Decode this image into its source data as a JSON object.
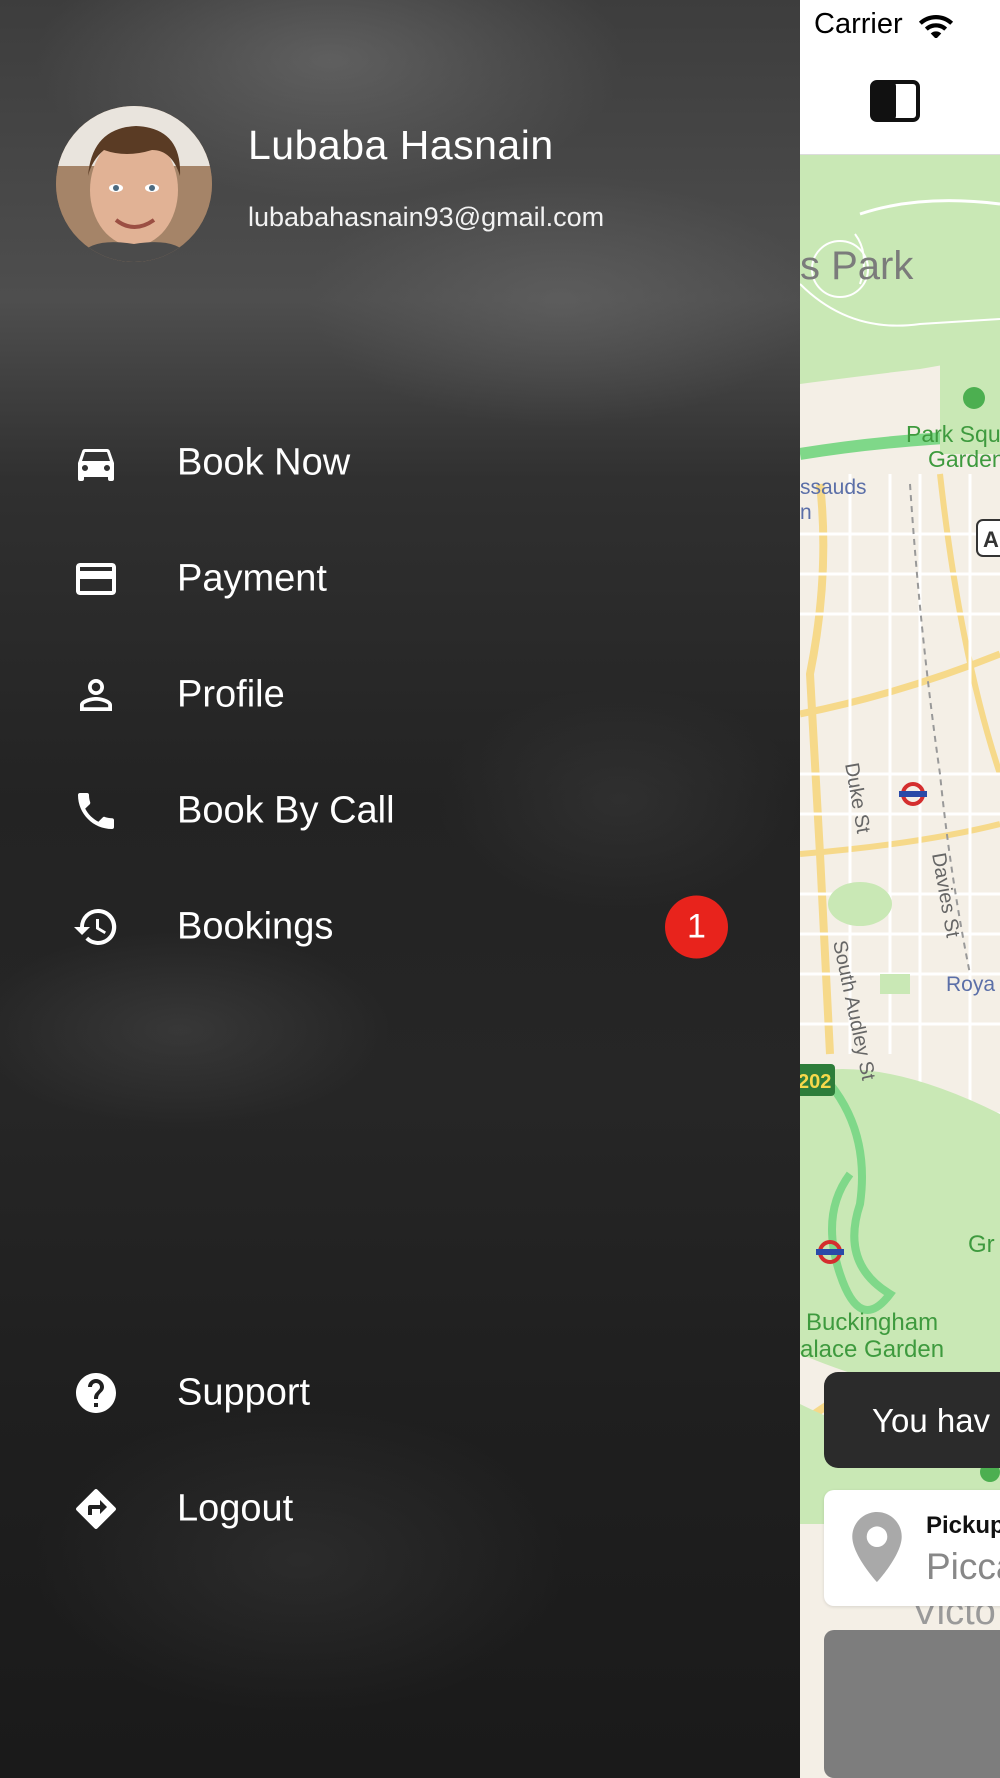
{
  "status_bar": {
    "carrier": "Carrier"
  },
  "drawer": {
    "user": {
      "name": "Lubaba Hasnain",
      "email": "lubabahasnain93@gmail.com"
    },
    "menu": [
      {
        "label": "Book Now",
        "icon": "car-icon"
      },
      {
        "label": "Payment",
        "icon": "credit-card-icon"
      },
      {
        "label": "Profile",
        "icon": "person-icon"
      },
      {
        "label": "Book By Call",
        "icon": "phone-icon"
      },
      {
        "label": "Bookings",
        "icon": "history-icon",
        "badge": "1"
      }
    ],
    "footer_menu": [
      {
        "label": "Support",
        "icon": "help-circle-icon"
      },
      {
        "label": "Logout",
        "icon": "directions-icon"
      }
    ]
  },
  "map": {
    "labels": {
      "park": "s Park",
      "park_square_1": "Park Squ",
      "park_square_2": "Garden",
      "tussauds_1": "ssauds",
      "tussauds_2": "n",
      "road_a": "A",
      "duke_st": "Duke St",
      "davies_st": "Davies St",
      "south_audley_st": "South Audley St",
      "royal": "Roya",
      "a202": "202",
      "green": "Gr",
      "buckingham_1": "Buckingham",
      "buckingham_2": "alace Garden",
      "victoria": "Victo"
    }
  },
  "toast": {
    "text": "You hav"
  },
  "pickup": {
    "label": "Pickup",
    "value": "Picca"
  },
  "colors": {
    "badge": "#e8231c",
    "park_green": "#c9e8b5",
    "route_green": "#7fd889",
    "road_yellow": "#f6d98a",
    "underground_red": "#d42e2e",
    "underground_blue": "#2a4aa8"
  }
}
